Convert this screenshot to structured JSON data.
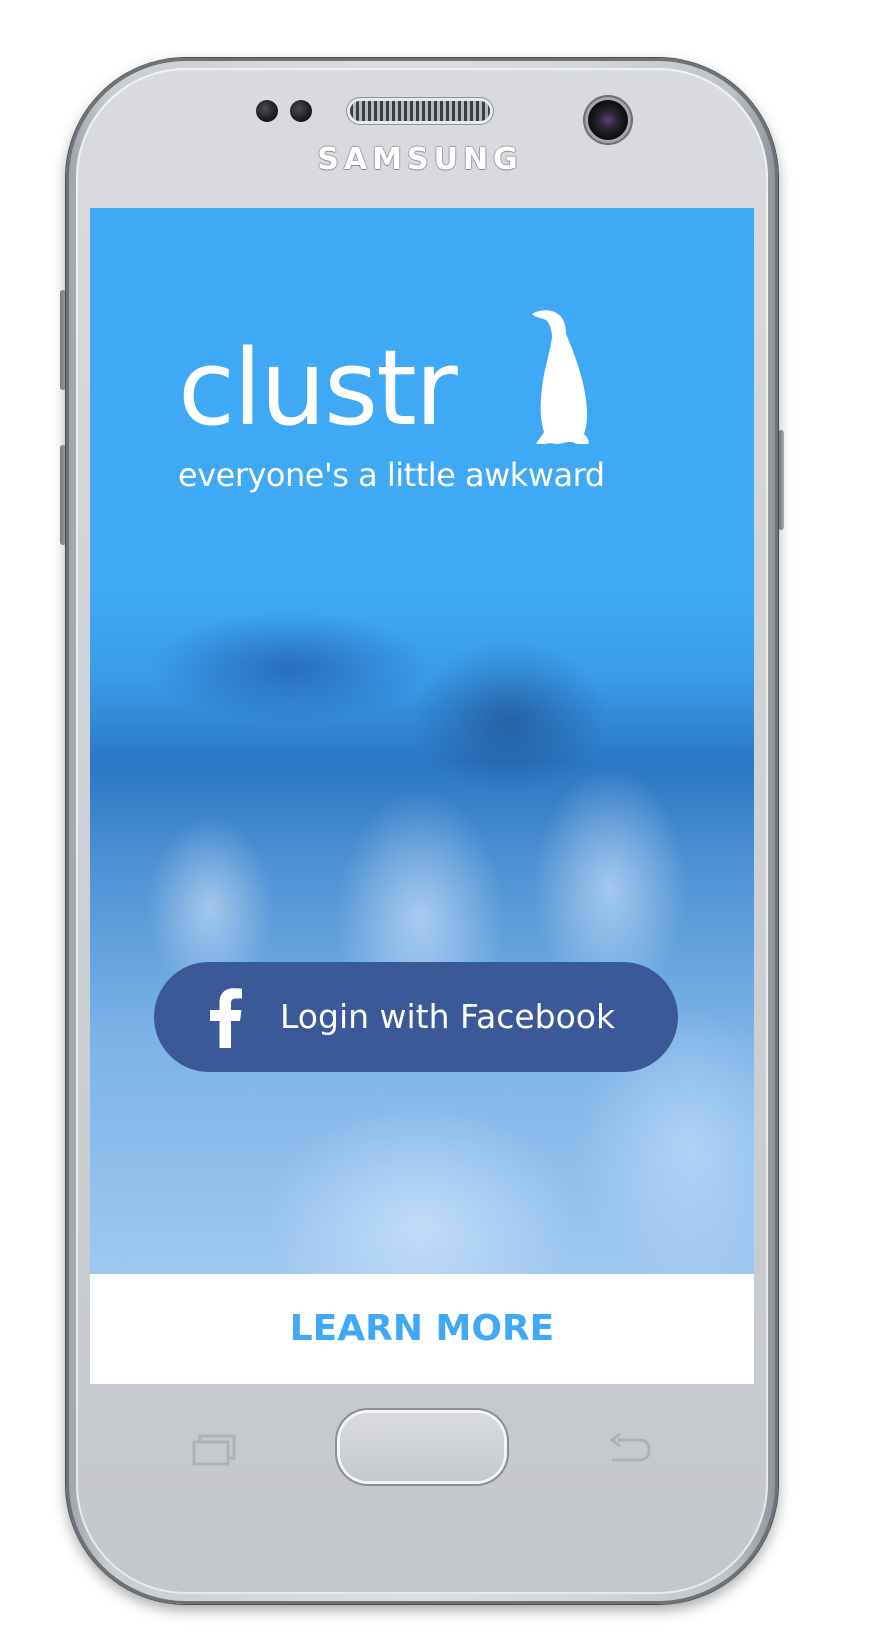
{
  "device": {
    "brand": "SAMSUNG"
  },
  "app": {
    "logo_text": "clustr",
    "tagline": "everyone's a little awkward",
    "facebook_button": {
      "icon": "facebook-f-icon",
      "label": "Login with Facebook"
    },
    "learn_more_label": "LEARN MORE"
  },
  "colors": {
    "brand_blue": "#3fa9f5",
    "facebook_blue": "#3b5998",
    "text_white": "#ffffff"
  },
  "hardware_icons": {
    "left": "recent-apps-icon",
    "center": "home-button",
    "right": "back-icon"
  }
}
